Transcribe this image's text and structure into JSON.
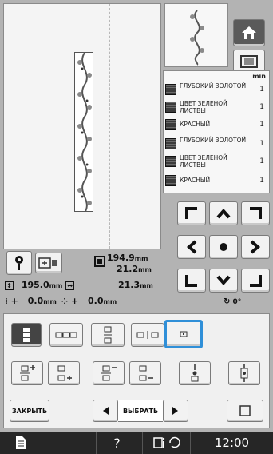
{
  "preview": {
    "dim_width": "194.9",
    "dim_height": "21.2",
    "dim_unit": "mm"
  },
  "thread_list": {
    "header": "min",
    "items": [
      {
        "name": "ГЛУБОКИЙ ЗОЛОТОЙ",
        "count": "1"
      },
      {
        "name": "ЦВЕТ ЗЕЛЕНОЙ ЛИСТВЫ",
        "count": "1"
      },
      {
        "name": "КРАСНЫЙ",
        "count": "1"
      },
      {
        "name": "ГЛУБОКИЙ ЗОЛОТОЙ",
        "count": "1"
      },
      {
        "name": "ЦВЕТ ЗЕЛЕНОЙ ЛИСТВЫ",
        "count": "1"
      },
      {
        "name": "КРАСНЫЙ",
        "count": "1"
      }
    ]
  },
  "info": {
    "height_value": "195.0",
    "width_value": "21.3",
    "offset_v": "0.0",
    "offset_h": "0.0",
    "unit": "mm",
    "plus": "+",
    "angle_value": "0°"
  },
  "panel": {
    "close_label": "ЗАКРЫТЬ",
    "select_label": "ВЫБРАТЬ"
  },
  "statusbar": {
    "time": "12:00",
    "help": "?"
  },
  "icons": {
    "home": "home-icon",
    "frame": "frame-icon",
    "info": "info-icon"
  }
}
